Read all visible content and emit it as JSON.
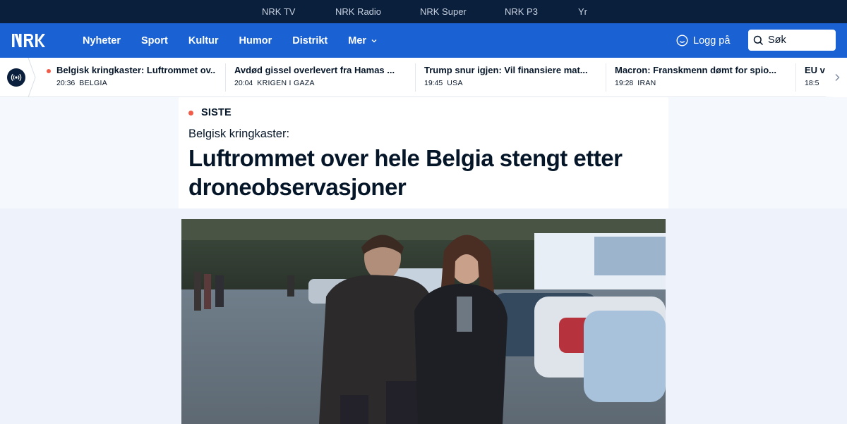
{
  "top_bar": {
    "links": [
      "NRK TV",
      "NRK Radio",
      "NRK Super",
      "NRK P3",
      "Yr"
    ]
  },
  "main_nav": {
    "logo_alt": "NRK",
    "links": [
      "Nyheter",
      "Sport",
      "Kultur",
      "Humor",
      "Distrikt",
      "Mer"
    ],
    "login_label": "Logg på",
    "search_label": "Søk"
  },
  "ticker": {
    "items": [
      {
        "title": "Belgisk kringkaster: Luftrommet ov...",
        "time": "20:36",
        "tag": "BELGIA",
        "live": true
      },
      {
        "title": "Avdød gissel overlevert fra Hamas ...",
        "time": "20:04",
        "tag": "KRIGEN I GAZA",
        "live": false
      },
      {
        "title": "Trump snur igjen: Vil finansiere mat...",
        "time": "19:45",
        "tag": "USA",
        "live": false
      },
      {
        "title": "Macron: Franskmenn dømt for spio...",
        "time": "19:28",
        "tag": "IRAN",
        "live": false
      },
      {
        "title": "EU v",
        "time": "18:5",
        "tag": "",
        "live": false
      }
    ]
  },
  "article": {
    "label": "SISTE",
    "kicker": "Belgisk kringkaster:",
    "headline": "Luftrommet over hele Belgia stengt etter droneobservasjoner"
  },
  "colors": {
    "top_bar": "#0a1f3c",
    "nav": "#1a61d4",
    "accent_red": "#f05c48",
    "text_dark": "#061629"
  }
}
